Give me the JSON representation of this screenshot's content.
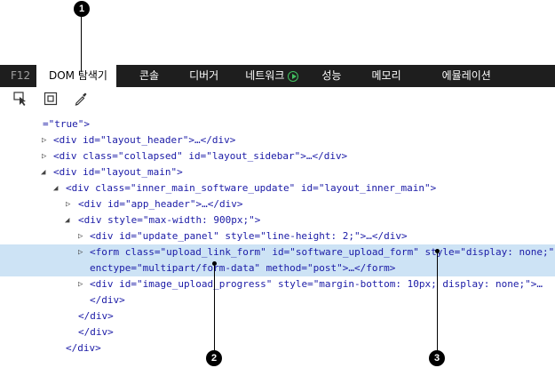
{
  "tabs": {
    "f12": "F12",
    "dom": "DOM 탐색기",
    "console": "콘솔",
    "debugger": "디버거",
    "network": "네트워크",
    "performance": "성능",
    "memory": "메모리",
    "emulation": "에뮬레이션"
  },
  "callouts": [
    "1",
    "2",
    "3"
  ],
  "code": {
    "l0": "=\"true\">",
    "l1": {
      "open": "<div ",
      "a1": "id=",
      "v1": "\"layout_header\"",
      "rest": ">…</div>"
    },
    "l2": {
      "open": "<div ",
      "a1": "class=",
      "v1": "\"collapsed\"",
      "a2": " id=",
      "v2": "\"layout_sidebar\"",
      "rest": ">…</div>"
    },
    "l3": {
      "open": "<div ",
      "a1": "id=",
      "v1": "\"layout_main\"",
      "rest": ">"
    },
    "l4": {
      "open": "<div ",
      "a1": "class=",
      "v1": "\"inner_main_software_update\"",
      "a2": " id=",
      "v2": "\"layout_inner_main\"",
      "rest": ">"
    },
    "l5": {
      "open": "<div ",
      "a1": "id=",
      "v1": "\"app_header\"",
      "rest": ">…</div>"
    },
    "l6": {
      "open": "<div ",
      "a1": "style=",
      "v1": "\"max-width: 900px;\"",
      "rest": ">"
    },
    "l7": {
      "open": "<div ",
      "a1": "id=",
      "v1": "\"update_panel\"",
      "a2": " style=",
      "v2": "\"line-height: 2;\"",
      "rest": ">…</div>"
    },
    "l8": {
      "open": "<form ",
      "a1": "class=",
      "v1": "\"upload_link_form\"",
      "a2": " id=",
      "v2": "\"software_upload_form\"",
      "a3": " style=",
      "v3": "\"display: none;\""
    },
    "l9": {
      "a1": "enctype=",
      "v1": "\"multipart/form-data\"",
      "a2": " method=",
      "v2": "\"post\"",
      "rest": ">…</form>"
    },
    "l10": {
      "open": "<div ",
      "a1": "id=",
      "v1": "\"image_upload_progress\"",
      "a2": " style=",
      "v2": "\"margin-bottom: 10px; display: none;\"",
      "rest": ">…"
    },
    "l11": "</div>",
    "l12": "</div>",
    "l13": "</div>",
    "l14": "</div>"
  }
}
